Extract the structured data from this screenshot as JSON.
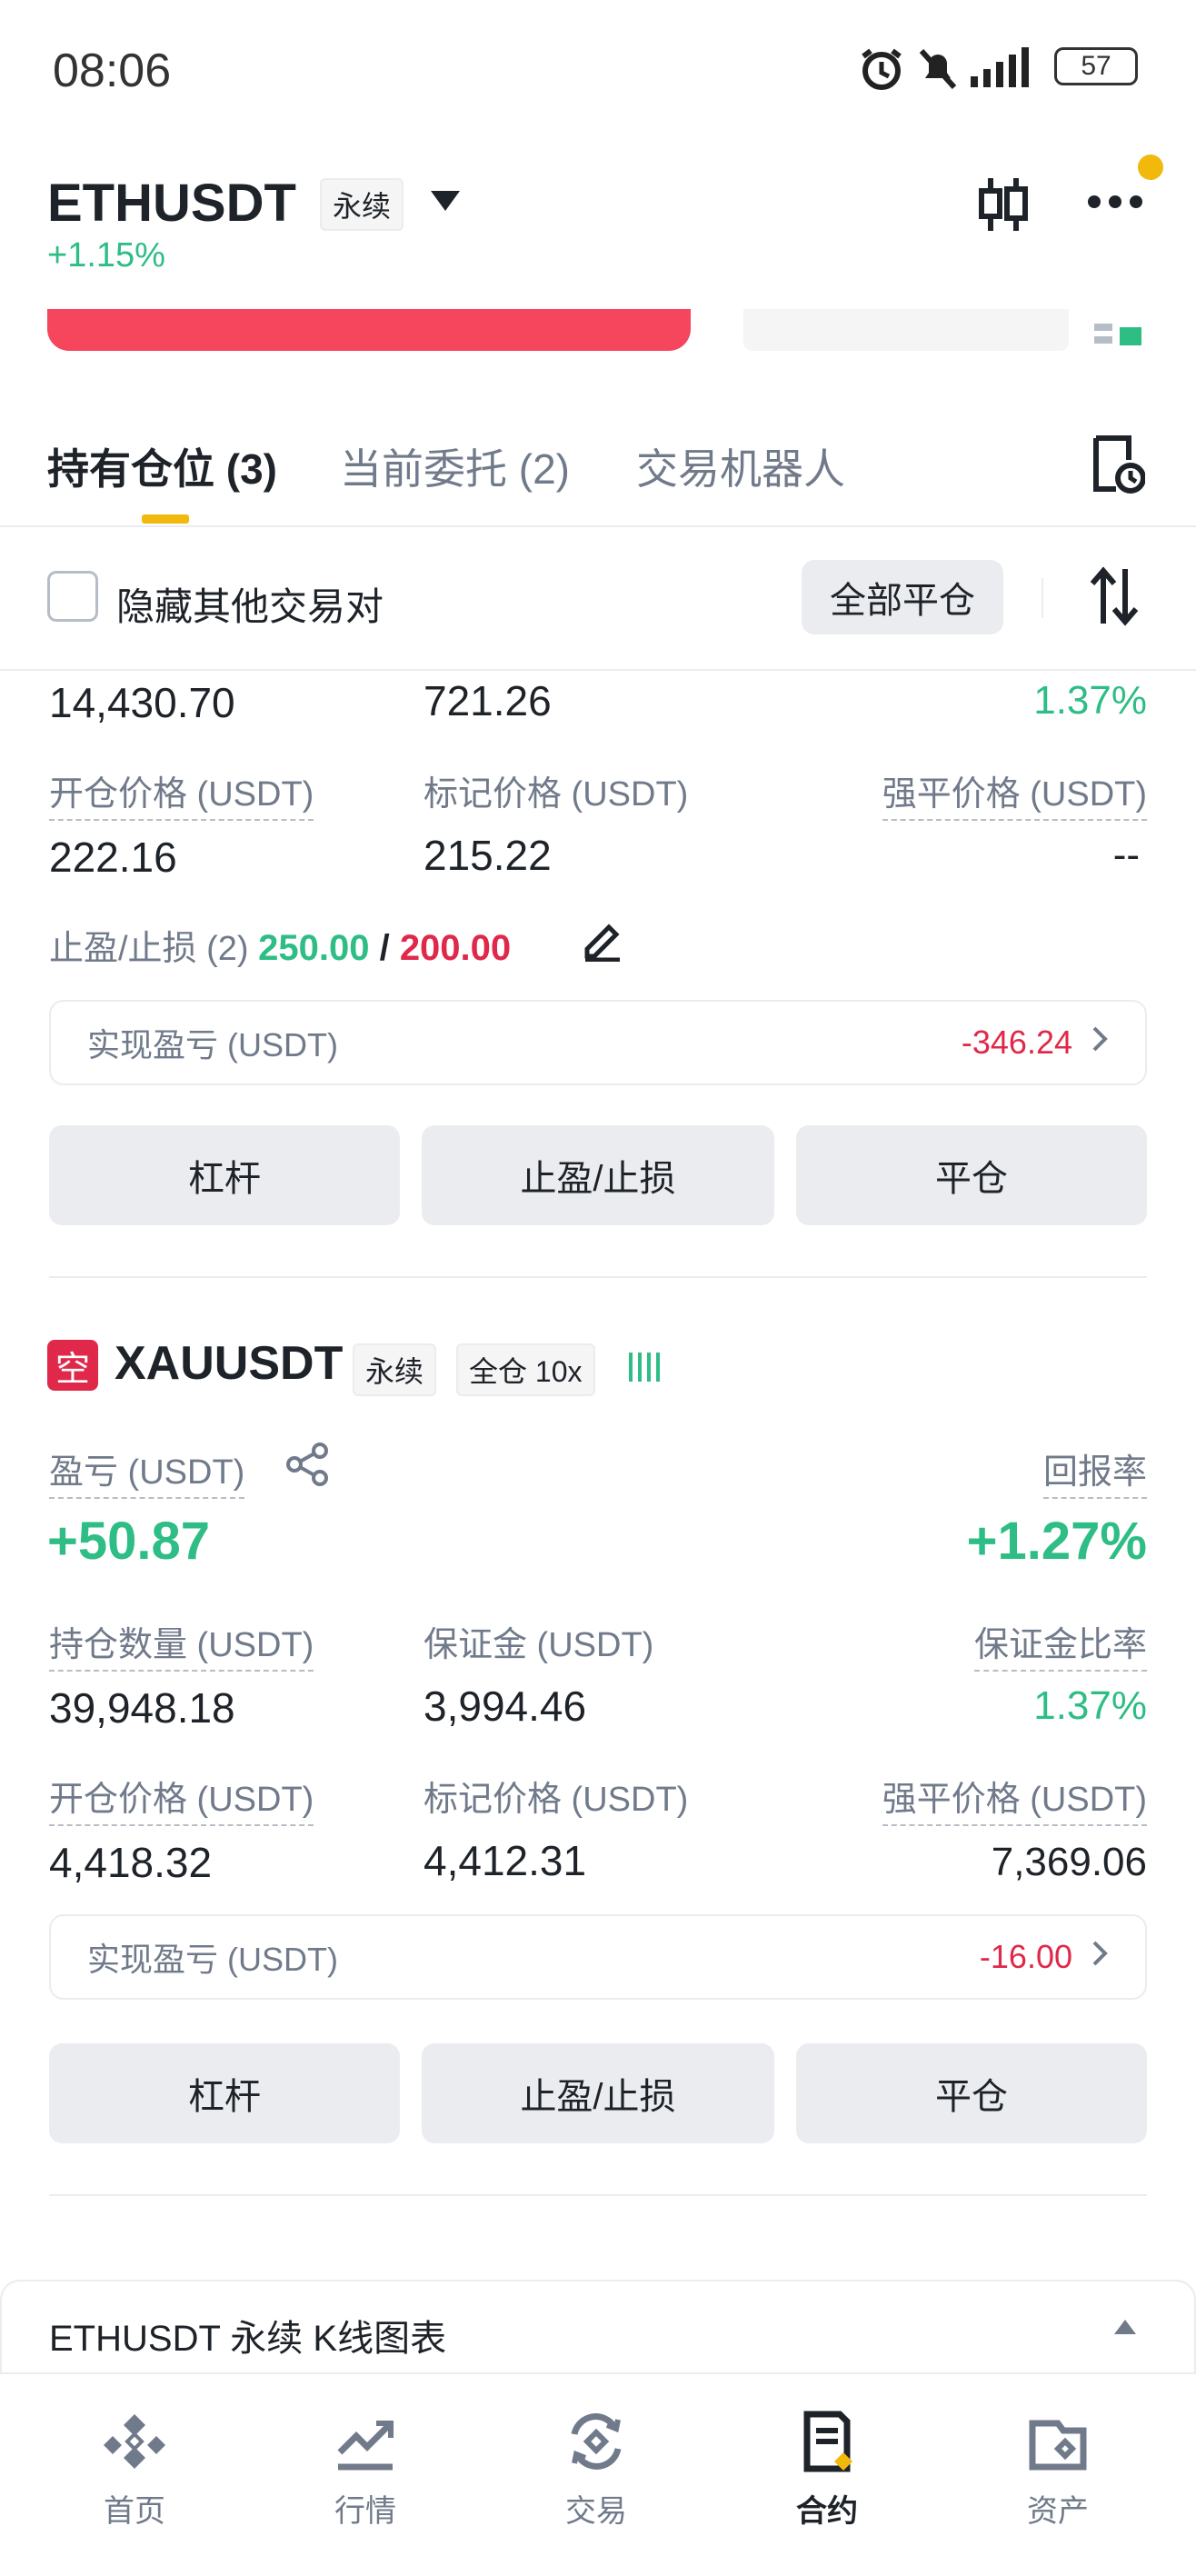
{
  "status_bar": {
    "time": "08:06",
    "battery": "57"
  },
  "header": {
    "symbol": "ETHUSDT",
    "type_tag": "永续",
    "change": "+1.15%"
  },
  "tabs": [
    {
      "label": "持有仓位 (3)"
    },
    {
      "label": "当前委托 (2)"
    },
    {
      "label": "交易机器人"
    }
  ],
  "filter": {
    "hide_label": "隐藏其他交易对",
    "close_all": "全部平仓"
  },
  "pos1": {
    "size": "14,430.70",
    "margin": "721.26",
    "margin_ratio": "1.37%",
    "entry_label": "开仓价格 (USDT)",
    "entry": "222.16",
    "mark_label": "标记价格 (USDT)",
    "mark": "215.22",
    "liq_label": "强平价格 (USDT)",
    "liq": "--",
    "tpsl_label": "止盈/止损 (2)",
    "tp": "250.00",
    "sep": " / ",
    "sl": "200.00",
    "realized_label": "实现盈亏 (USDT)",
    "realized": "-346.24",
    "btn_leverage": "杠杆",
    "btn_tpsl": "止盈/止损",
    "btn_close": "平仓"
  },
  "pos2": {
    "side": "空",
    "symbol": "XAUUSDT",
    "type_tag": "永续",
    "margin_tag": "全仓 10x",
    "pnl_label": "盈亏 (USDT)",
    "roe_label": "回报率",
    "pnl": "+50.87",
    "roe": "+1.27%",
    "size_label": "持仓数量 (USDT)",
    "margin_label": "保证金 (USDT)",
    "ratio_label": "保证金比率",
    "size": "39,948.18",
    "margin": "3,994.46",
    "margin_ratio": "1.37%",
    "entry_label": "开仓价格 (USDT)",
    "mark_label": "标记价格 (USDT)",
    "liq_label": "强平价格 (USDT)",
    "entry": "4,418.32",
    "mark": "4,412.31",
    "liq": "7,369.06",
    "realized_label": "实现盈亏 (USDT)",
    "realized": "-16.00",
    "btn_leverage": "杠杆",
    "btn_tpsl": "止盈/止损",
    "btn_close": "平仓"
  },
  "chart_bar": {
    "label": "ETHUSDT 永续 K线图表"
  },
  "bottom_nav": [
    {
      "label": "首页"
    },
    {
      "label": "行情"
    },
    {
      "label": "交易"
    },
    {
      "label": "合约"
    },
    {
      "label": "资产"
    }
  ],
  "colors": {
    "green": "#2ebd85",
    "red": "#e0294a",
    "accent": "#f0b90b"
  }
}
